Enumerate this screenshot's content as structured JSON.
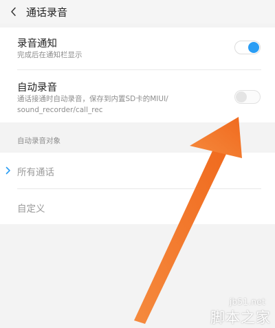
{
  "header": {
    "title": "通话录音",
    "back_icon": "chevron-left-icon"
  },
  "settings": {
    "notification": {
      "title": "录音通知",
      "subtitle": "完成后在通知栏显示",
      "enabled": true
    },
    "auto_record": {
      "title": "自动录音",
      "subtitle_line1": "通话接通时自动录音，保存到内置SD卡的MIUI/",
      "subtitle_line2": "sound_recorder/call_rec",
      "enabled": false
    }
  },
  "auto_record_targets": {
    "section_title": "自动录音对象",
    "options": [
      {
        "label": "所有通话",
        "selected": true
      },
      {
        "label": "自定义",
        "selected": false
      }
    ]
  },
  "watermark": {
    "url": "jb51.net",
    "logo": "脚本之家"
  },
  "colors": {
    "accent": "#2a9df4",
    "annotation_arrow": "#f47a2a"
  }
}
